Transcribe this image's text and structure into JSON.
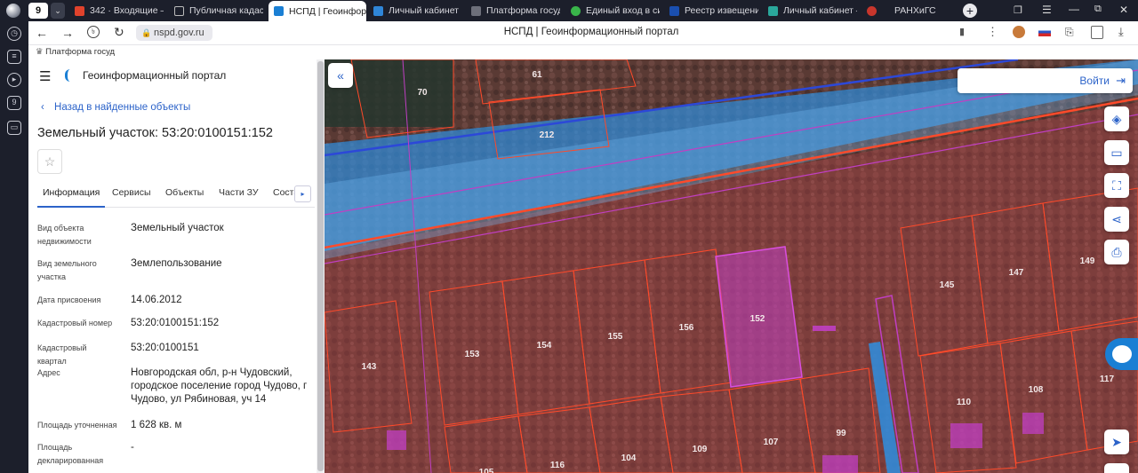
{
  "browser": {
    "tab_count": "9",
    "tabs": [
      {
        "label": "342 · Входящие — Я",
        "color": "#e0422c"
      },
      {
        "label": "Публичная кадастр",
        "color": "#6d6f7a"
      },
      {
        "label": "НСПД | Геоинфор",
        "color": "#1a7fd4"
      },
      {
        "label": "Личный кабинет",
        "color": "#2f86d8"
      },
      {
        "label": "Платформа государ",
        "color": "#6d6f7a"
      },
      {
        "label": "Единый вход в систе",
        "color": "#39b54a"
      },
      {
        "label": "Реестр извещений",
        "color": "#1a4fb0"
      },
      {
        "label": "Личный кабинет —",
        "color": "#2aa79b"
      },
      {
        "label": "РАНХиГС",
        "color": "#c8362c"
      }
    ],
    "url": "nspd.gov.ru",
    "page_title": "НСПД | Геоинформационный портал",
    "bookmark": "Платформа госуд"
  },
  "sidebar": {
    "portal_title": "Геоинформационный портал",
    "back_link": "Назад в найденные объекты",
    "object_title": "Земельный участок: 53:20:0100151:152",
    "tabs": [
      "Информация",
      "Сервисы",
      "Объекты",
      "Части ЗУ",
      "Состав"
    ],
    "fields": [
      {
        "label": "Вид объекта недвижимости",
        "value": "Земельный участок"
      },
      {
        "label": "Вид земельного участка",
        "value": "Землепользование"
      },
      {
        "label": "Дата присвоения",
        "value": "14.06.2012"
      },
      {
        "label": "Кадастровый номер",
        "value": "53:20:0100151:152"
      },
      {
        "label": "Кадастровый квартал",
        "value": "53:20:0100151"
      },
      {
        "label": "Адрес",
        "value": "Новгородская обл, р-н Чудовский, городское поселение город Чудово, г Чудово, ул Рябиновая, уч 14"
      },
      {
        "label": "Площадь уточненная",
        "value": "1 628 кв. м"
      },
      {
        "label": "Площадь декларированная",
        "value": "-"
      }
    ]
  },
  "map": {
    "login_label": "Войти",
    "parcel_numbers": [
      "70",
      "61",
      "212",
      "145",
      "147",
      "149",
      "143",
      "153",
      "154",
      "155",
      "156",
      "152",
      "110",
      "108",
      "117",
      "107",
      "99",
      "109",
      "104",
      "116",
      "105"
    ],
    "highlight_color": "#c03fc3",
    "boundary_color": "#ff4a2a"
  }
}
